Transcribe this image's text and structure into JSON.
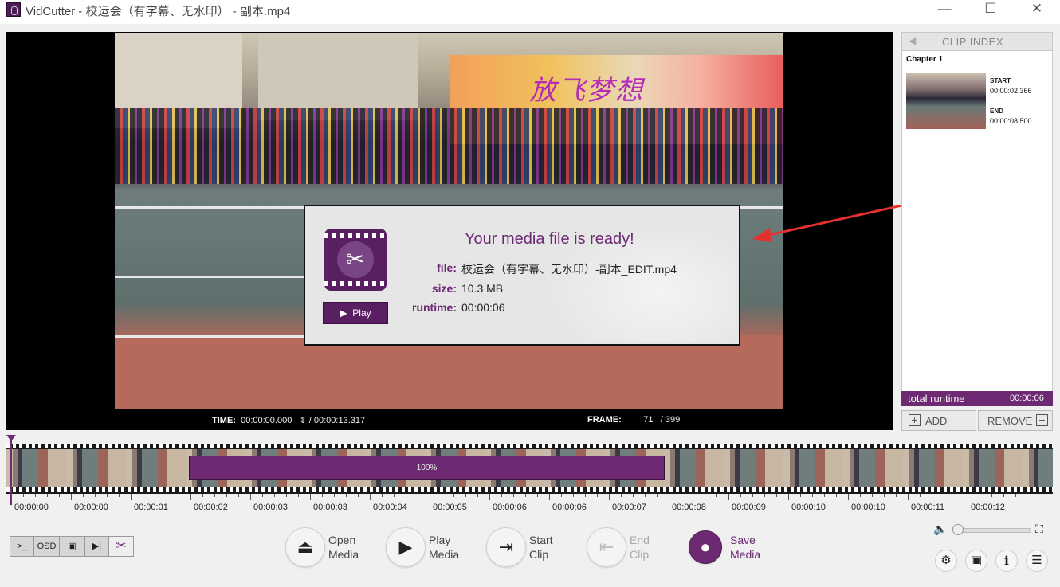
{
  "window": {
    "title": "VidCutter - 校运会（有字幕、无水印） - 副本.mp4",
    "minimize": "—",
    "maximize": "☐",
    "close": "✕"
  },
  "video": {
    "banner_text": "放飞梦想"
  },
  "dialog": {
    "title": "Your media file is ready!",
    "file_label": "file:",
    "file_value": "校运会（有字幕、无水印）-副本_EDIT.mp4",
    "size_label": "size:",
    "size_value": "10.3 MB",
    "runtime_label": "runtime:",
    "runtime_value": "00:00:06",
    "play_label": "Play",
    "play_icon": "▶"
  },
  "timebar": {
    "time_label": "TIME:",
    "time_value": "00:00:00.000",
    "spinner": "⇕",
    "duration": "/  00:00:13.317",
    "frame_label": "FRAME:",
    "frame_value": "71",
    "frame_total": "/  399"
  },
  "clip_index": {
    "collapse_icon": "◀",
    "title": "CLIP INDEX",
    "chapter": "Chapter 1",
    "start_label": "START",
    "start_value": "00:00:02.366",
    "end_label": "END",
    "end_value": "00:00:08.500",
    "total_label": "total runtime",
    "total_value": "00:00:06",
    "add_label": "ADD",
    "remove_label": "REMOVE",
    "add_icon": "+",
    "remove_icon": "−"
  },
  "timeline": {
    "clip_percent": "100%",
    "ticks": [
      "00:00:00",
      "00:00:00",
      "00:00:01",
      "00:00:02",
      "00:00:03",
      "00:00:03",
      "00:00:04",
      "00:00:05",
      "00:00:06",
      "00:00:06",
      "00:00:07",
      "00:00:08",
      "00:00:09",
      "00:00:10",
      "00:00:10",
      "00:00:11",
      "00:00:12"
    ]
  },
  "tools": {
    "console": ">_",
    "osd": "OSD",
    "subtitle": "▣",
    "skip": "▶|",
    "cut": "✂"
  },
  "controls": {
    "open": "Open\nMedia",
    "play": "Play\nMedia",
    "start": "Start\nClip",
    "end": "End\nClip",
    "save": "Save\nMedia",
    "open_icon": "⏏",
    "play_icon": "▶",
    "start_icon": "⇥",
    "end_icon": "⇤",
    "save_icon": "●"
  },
  "right_controls": {
    "volume_icon": "🔈",
    "fullscreen_icon": "⛶",
    "settings_icon": "⚙",
    "camera_icon": "▣",
    "info_icon": "i",
    "menu_icon": "☰"
  }
}
